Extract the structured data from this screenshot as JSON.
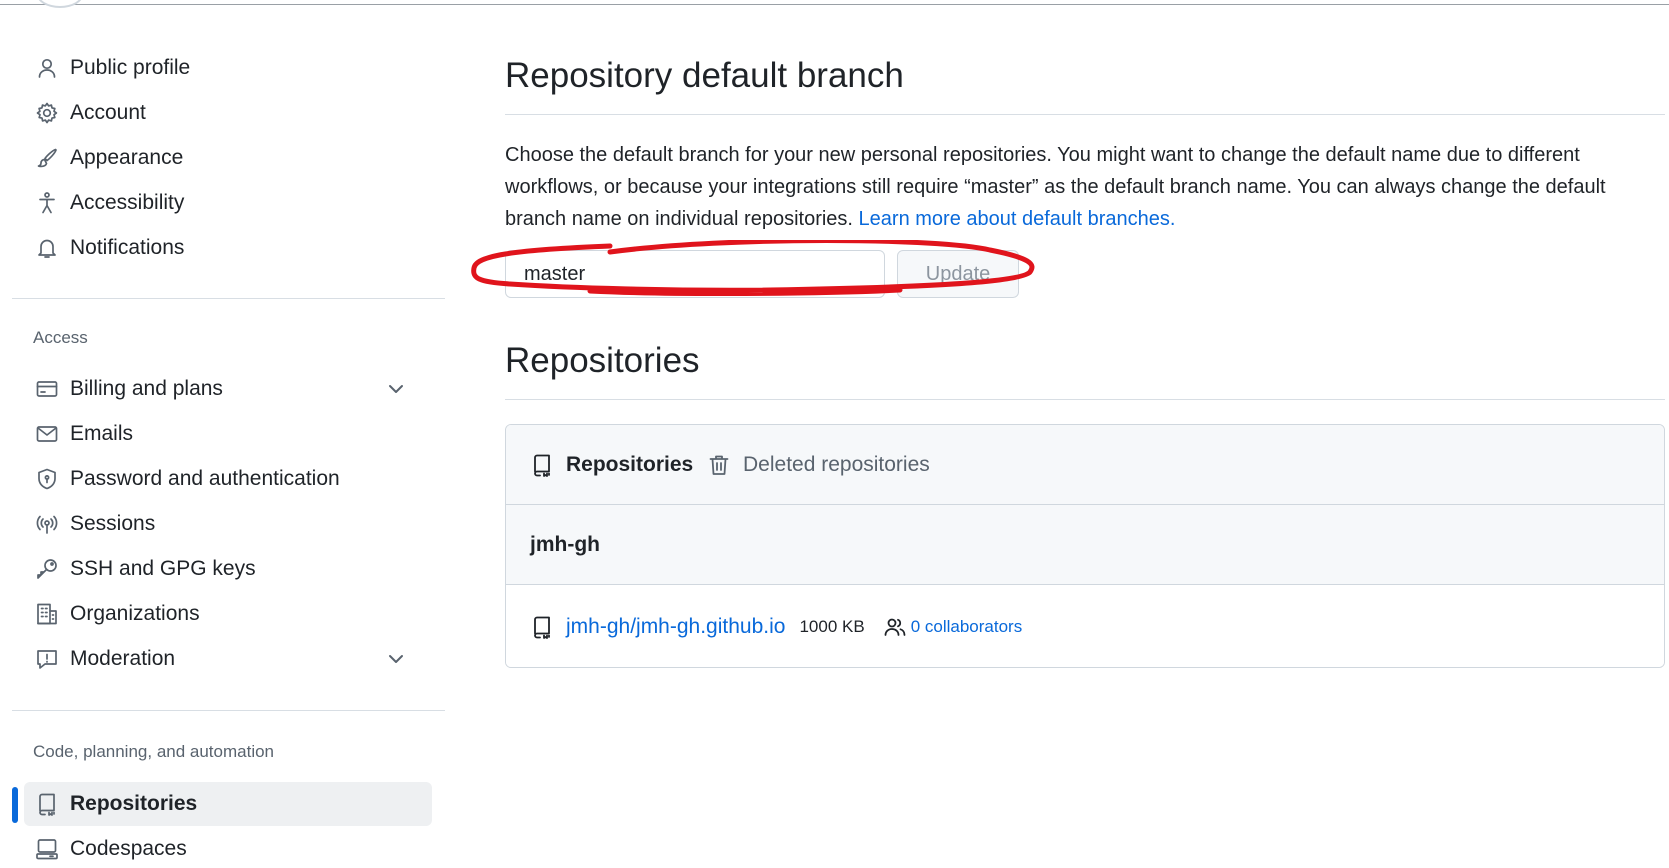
{
  "sidebar": {
    "group1": [
      {
        "label": "Public profile",
        "icon": "person-icon"
      },
      {
        "label": "Account",
        "icon": "gear-icon"
      },
      {
        "label": "Appearance",
        "icon": "paintbrush-icon"
      },
      {
        "label": "Accessibility",
        "icon": "accessibility-icon"
      },
      {
        "label": "Notifications",
        "icon": "bell-icon"
      }
    ],
    "access_heading": "Access",
    "group2": [
      {
        "label": "Billing and plans",
        "icon": "credit-card-icon"
      },
      {
        "label": "Emails",
        "icon": "mail-icon"
      },
      {
        "label": "Password and authentication",
        "icon": "shield-lock-icon"
      },
      {
        "label": "Sessions",
        "icon": "broadcast-icon"
      },
      {
        "label": "SSH and GPG keys",
        "icon": "key-icon"
      },
      {
        "label": "Organizations",
        "icon": "organization-icon"
      },
      {
        "label": "Moderation",
        "icon": "report-icon"
      }
    ],
    "code_heading": "Code, planning, and automation",
    "group3": [
      {
        "label": "Repositories",
        "icon": "repo-icon"
      },
      {
        "label": "Codespaces",
        "icon": "codespaces-icon"
      }
    ]
  },
  "default_branch": {
    "title": "Repository default branch",
    "description": "Choose the default branch for your new personal repositories. You might want to change the default name due to different workflows, or because your integrations still require “master” as the default branch name. You can always change the default branch name on individual repositories.",
    "learn_more": "Learn more about default branches.",
    "input_value": "master",
    "update_label": "Update"
  },
  "repositories": {
    "title": "Repositories",
    "tabs": [
      "Repositories",
      "Deleted repositories"
    ],
    "owner": "jmh-gh",
    "repo_name": "jmh-gh/jmh-gh.github.io",
    "repo_size": "1000 KB",
    "collaborators": "0 collaborators"
  },
  "colors": {
    "accent": "#0969da",
    "annotation": "#e0141c"
  }
}
